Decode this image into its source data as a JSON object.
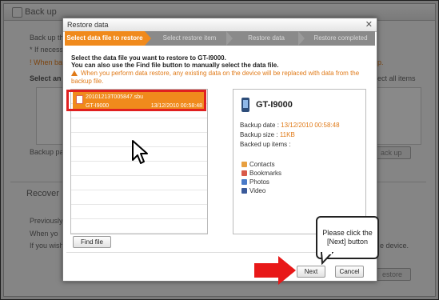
{
  "background_app": {
    "backup_title": "Back up",
    "backup_line1": "Back up th",
    "backup_line2": "* If necess",
    "backup_line3": "! When ba",
    "backup_line3_right": "p.",
    "select_all_left": "Select an",
    "select_all_right": "ect all items",
    "backup_path": "Backup pa",
    "backup_button": "ack up",
    "recover_title": "Recover",
    "recover_line1": "Previously",
    "recover_line2": "When yo",
    "recover_line3": "If you wish",
    "recover_line3_right": "e device.",
    "restore_button": "estore"
  },
  "dialog": {
    "title": "Restore data",
    "close": "✕",
    "steps": [
      "Select data file to restore",
      "Select restore item",
      "Restore data",
      "Restore completed"
    ],
    "instruction_1": "Select the data file you want to restore to GT-I9000.",
    "instruction_2": "You can also use the Find file button to manually select the data file.",
    "warning": "When you perform data restore, any existing data on the device will be replaced with data from the backup file.",
    "file": {
      "name": "20101213T005847.sbu",
      "device": "GT-I9000",
      "date": "13/12/2010 00:58:48"
    },
    "details": {
      "model": "GT-I9000",
      "backup_date_label": "Backup date : ",
      "backup_date": "13/12/2010 00:58:48",
      "backup_size_label": "Backup size : ",
      "backup_size": "11KB",
      "backed_up_items_label": "Backed up items :",
      "items": [
        "Contacts",
        "Bookmarks",
        "Photos",
        "Video"
      ]
    },
    "find_file_button": "Find file",
    "next_button": "Next",
    "cancel_button": "Cancel"
  },
  "callout": {
    "text": "Please click the [Next] button"
  },
  "colors": {
    "accent": "#f08a1c",
    "highlight": "#e02020"
  }
}
